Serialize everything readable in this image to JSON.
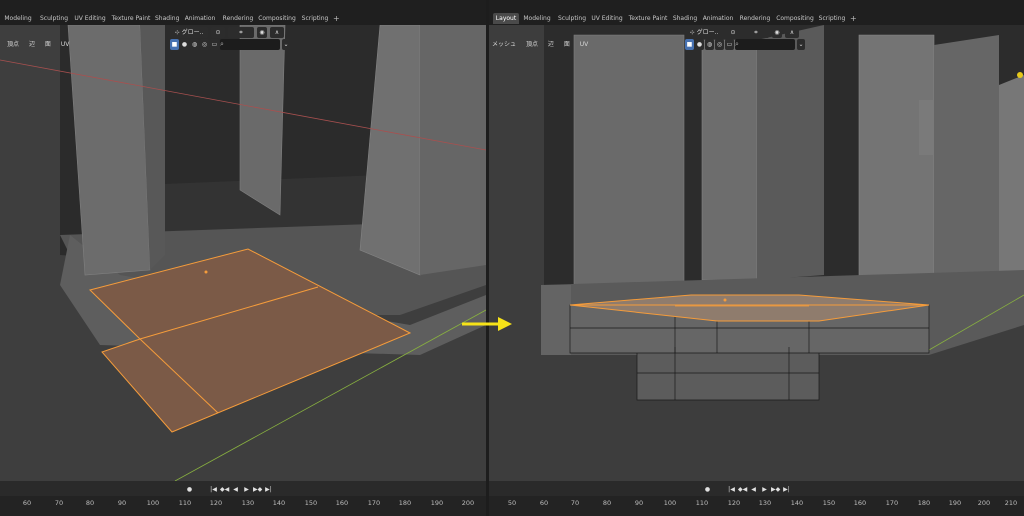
{
  "left": {
    "tabs": [
      "Modeling",
      "Sculpting",
      "UV Editing",
      "Texture Paint",
      "Shading",
      "Animation",
      "Rendering",
      "Compositing",
      "Scripting"
    ],
    "add_tab": "+",
    "header_modes": [
      "頂点",
      "辺",
      "面",
      "UV"
    ],
    "orientation_label": "グロー..",
    "frame_ticks": [
      "60",
      "70",
      "80",
      "90",
      "100",
      "110",
      "120",
      "130",
      "140",
      "150",
      "160",
      "170",
      "180",
      "190",
      "200"
    ]
  },
  "right": {
    "tabs": [
      "Layout",
      "Modeling",
      "Sculpting",
      "UV Editing",
      "Texture Paint",
      "Shading",
      "Animation",
      "Rendering",
      "Compositing",
      "Scripting"
    ],
    "active_tab": "Layout",
    "add_tab": "+",
    "header_modes": [
      "メッシュ",
      "頂点",
      "辺",
      "面",
      "UV"
    ],
    "orientation_label": "グロー..",
    "frame_ticks": [
      "50",
      "60",
      "70",
      "80",
      "90",
      "100",
      "110",
      "120",
      "130",
      "140",
      "150",
      "160",
      "170",
      "180",
      "190",
      "200",
      "210"
    ]
  },
  "playback": {
    "record": "●",
    "jump_start": "|◀",
    "prev_key": "◆◀",
    "play_rev": "◀",
    "play": "▶",
    "next_key": "▶◆",
    "jump_end": "▶|"
  },
  "colors": {
    "accent": "#4771b0",
    "selection_orange": "#f59c3b",
    "arrow_yellow": "#f7e318",
    "viewport_bg": "#3c3c3c",
    "x_axis": "#a8504f",
    "y_axis": "#88b040"
  },
  "icons": [
    "transform-orientation-icon",
    "pivot-icon",
    "snap-icon",
    "proportional-icon",
    "viewport-shading-icon",
    "search-icon",
    "arrow-right-icon"
  ]
}
